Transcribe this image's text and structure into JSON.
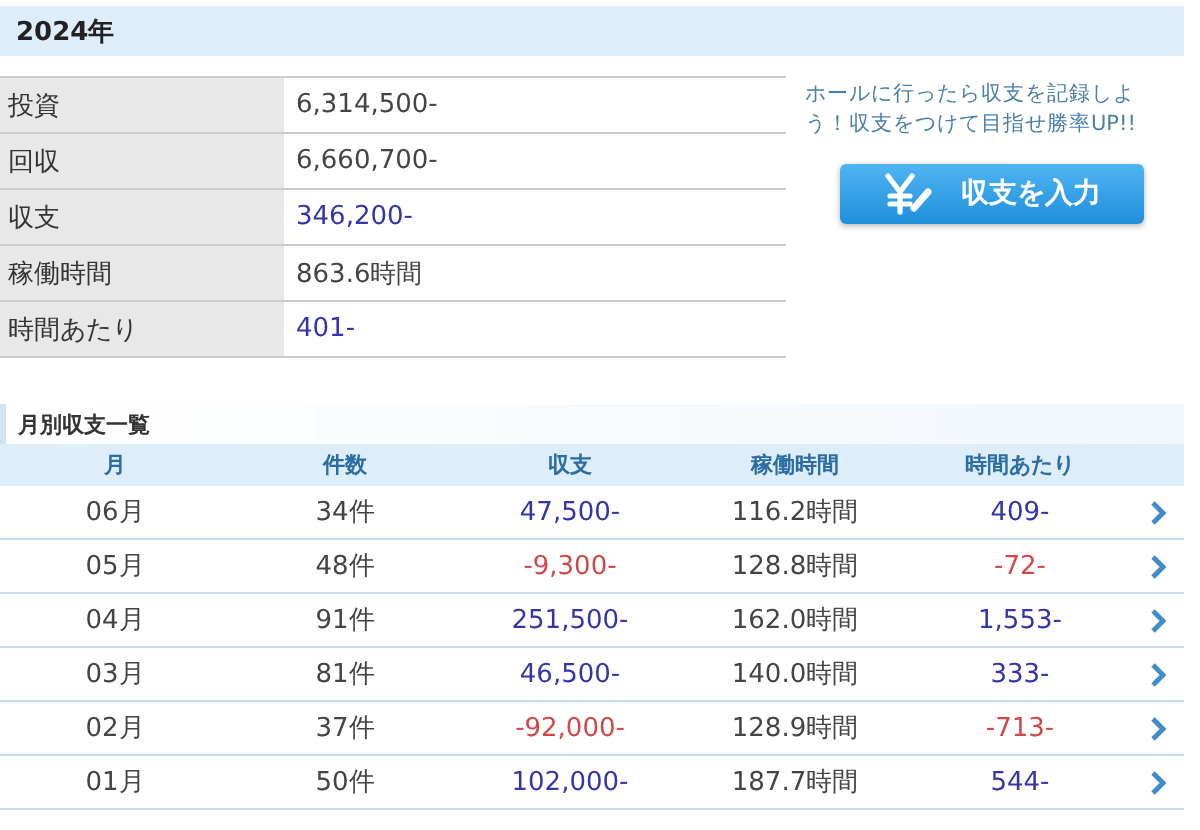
{
  "year_header": "2024年",
  "summary": [
    {
      "label": "投資",
      "value": "6,314,500-",
      "kind": "plain"
    },
    {
      "label": "回収",
      "value": "6,660,700-",
      "kind": "plain"
    },
    {
      "label": "収支",
      "value": "346,200-",
      "kind": "gain"
    },
    {
      "label": "稼働時間",
      "value": "863.6時間",
      "kind": "plain"
    },
    {
      "label": "時間あたり",
      "value": "401-",
      "kind": "gain"
    }
  ],
  "promo": {
    "message": "ホールに行ったら収支を記録しよう！収支をつけて目指せ勝率UP!!",
    "button": "収支を入力"
  },
  "monthly": {
    "title": "月別収支一覧",
    "columns": [
      "月",
      "件数",
      "収支",
      "稼働時間",
      "時間あたり"
    ],
    "rows": [
      {
        "kind": "gain",
        "cells": [
          "06月",
          "34件",
          "47,500-",
          "116.2時間",
          "409-"
        ]
      },
      {
        "kind": "loss",
        "cells": [
          "05月",
          "48件",
          "-9,300-",
          "128.8時間",
          "-72-"
        ]
      },
      {
        "kind": "gain",
        "cells": [
          "04月",
          "91件",
          "251,500-",
          "162.0時間",
          "1,553-"
        ]
      },
      {
        "kind": "gain",
        "cells": [
          "03月",
          "81件",
          "46,500-",
          "140.0時間",
          "333-"
        ]
      },
      {
        "kind": "loss",
        "cells": [
          "02月",
          "37件",
          "-92,000-",
          "128.9時間",
          "-713-"
        ]
      },
      {
        "kind": "gain",
        "cells": [
          "01月",
          "50件",
          "102,000-",
          "187.7時間",
          "544-"
        ]
      }
    ]
  }
}
